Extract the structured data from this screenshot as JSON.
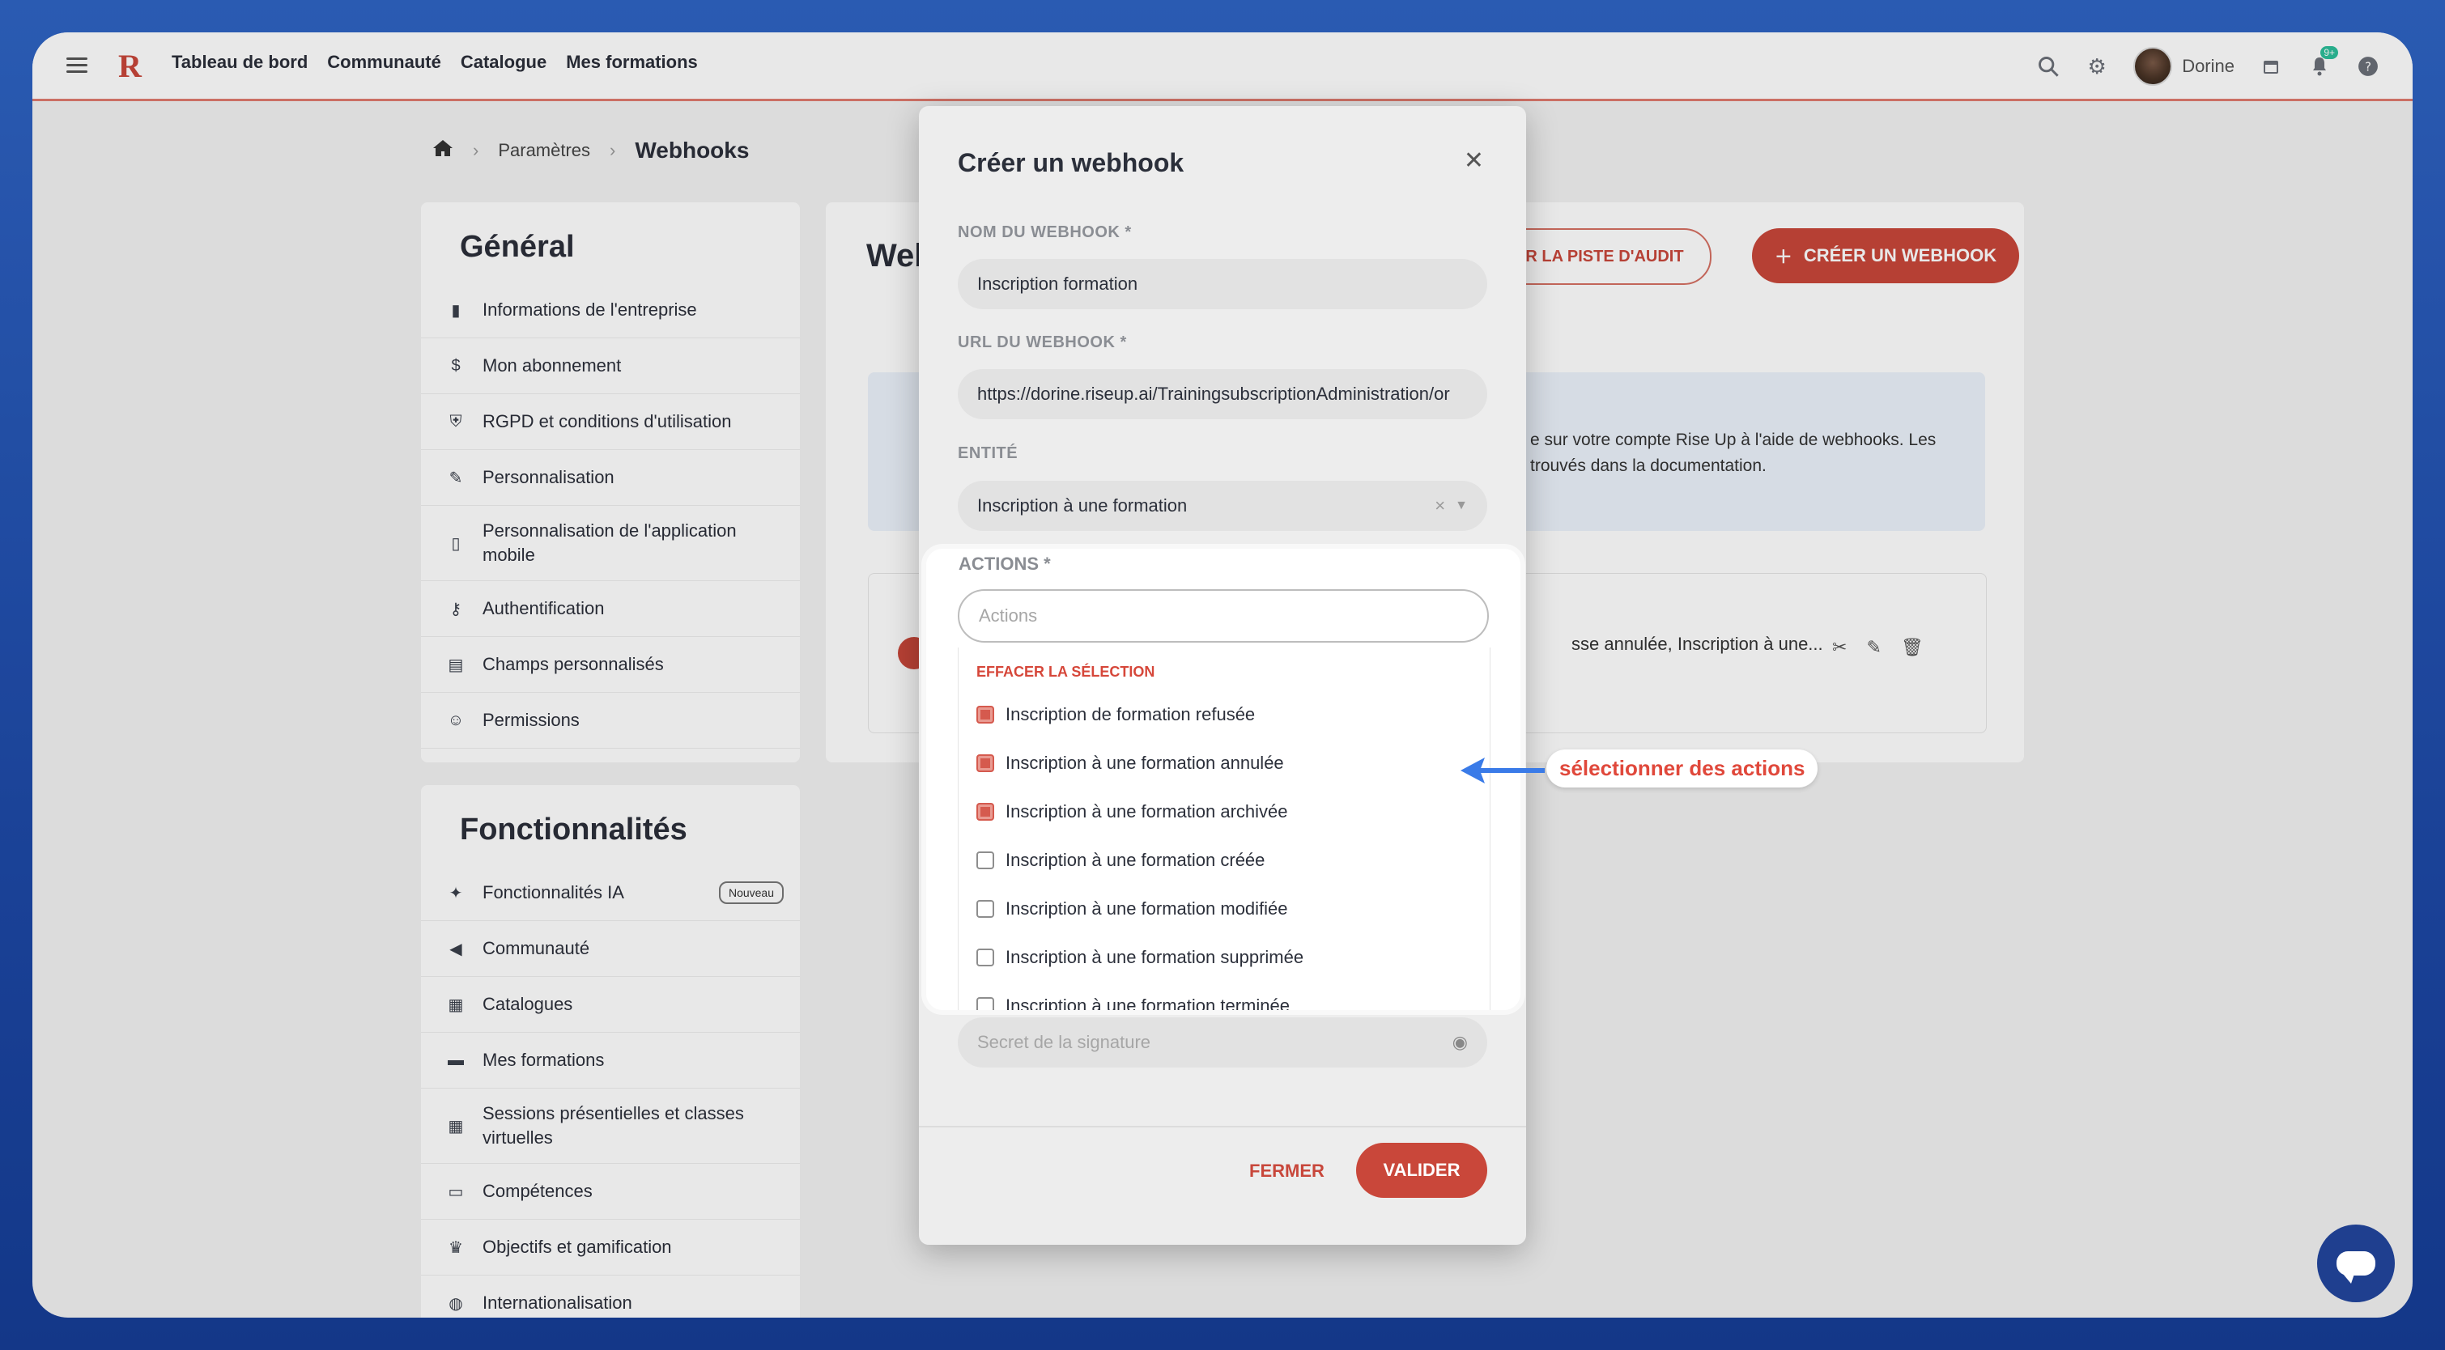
{
  "topbar": {
    "logo": "R",
    "nav": [
      "Tableau de bord",
      "Communauté",
      "Catalogue",
      "Mes formations"
    ],
    "user_name": "Dorine",
    "notif_count": "9+"
  },
  "breadcrumb": {
    "home_icon": "home-icon",
    "items": [
      "Paramètres",
      "Webhooks"
    ]
  },
  "sidebar_general": {
    "title": "Général",
    "items": [
      {
        "icon": "building",
        "label": "Informations de l'entreprise"
      },
      {
        "icon": "dollar",
        "label": "Mon abonnement"
      },
      {
        "icon": "shield",
        "label": "RGPD et conditions d'utilisation"
      },
      {
        "icon": "brush",
        "label": "Personnalisation"
      },
      {
        "icon": "phone",
        "label": "Personnalisation de l'application mobile"
      },
      {
        "icon": "key",
        "label": "Authentification"
      },
      {
        "icon": "table",
        "label": "Champs personnalisés"
      },
      {
        "icon": "user-cog",
        "label": "Permissions"
      }
    ]
  },
  "sidebar_features": {
    "title": "Fonctionnalités",
    "items": [
      {
        "icon": "sparkles",
        "label": "Fonctionnalités IA",
        "badge": "Nouveau"
      },
      {
        "icon": "megaphone",
        "label": "Communauté"
      },
      {
        "icon": "grid",
        "label": "Catalogues"
      },
      {
        "icon": "book",
        "label": "Mes formations"
      },
      {
        "icon": "calendar",
        "label": "Sessions présentielles et classes virtuelles"
      },
      {
        "icon": "skill",
        "label": "Compétences"
      },
      {
        "icon": "trophy",
        "label": "Objectifs et gamification"
      },
      {
        "icon": "globe",
        "label": "Internationalisation"
      }
    ]
  },
  "main": {
    "title_partial": "Web",
    "audit_button": "R LA PISTE D'AUDIT",
    "create_button": "CRÉER UN WEBHOOK",
    "info_line1": "e sur votre compte Rise Up à l'aide de webhooks. Les",
    "info_line2": "trouvés dans la documentation.",
    "row_text": "sse annulée, Inscription à une..."
  },
  "modal": {
    "title": "Créer un webhook",
    "name_label": "NOM DU WEBHOOK *",
    "name_value": "Inscription formation",
    "url_label": "URL DU WEBHOOK *",
    "url_value": "https://dorine.riseup.ai/TrainingsubscriptionAdministration/or",
    "entity_label": "ENTITÉ",
    "entity_value": "Inscription à une formation",
    "actions_label": "ACTIONS *",
    "actions_placeholder": "Actions",
    "clear_selection": "EFFACER LA SÉLECTION",
    "options": [
      {
        "label": "Inscription de formation refusée",
        "checked": true
      },
      {
        "label": "Inscription à une formation annulée",
        "checked": true
      },
      {
        "label": "Inscription à une formation archivée",
        "checked": true
      },
      {
        "label": "Inscription à une formation créée",
        "checked": false
      },
      {
        "label": "Inscription à une formation modifiée",
        "checked": false
      },
      {
        "label": "Inscription à une formation supprimée",
        "checked": false
      },
      {
        "label": "Inscription à une formation terminée",
        "checked": false
      }
    ],
    "secret_placeholder": "Secret de la signature",
    "close_button": "FERMER",
    "submit_button": "VALIDER"
  },
  "annotation": {
    "label": "sélectionner des actions"
  },
  "colors": {
    "accent": "#c9473a",
    "annotation_arrow": "#3a7be8",
    "background": "#2f64c4"
  }
}
